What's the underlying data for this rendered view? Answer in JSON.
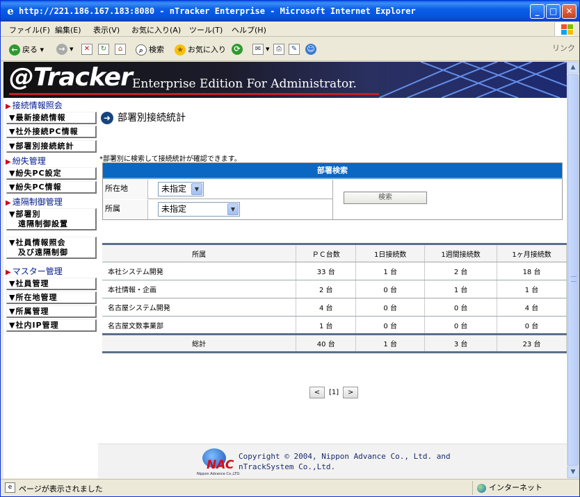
{
  "window": {
    "title": "http://221.186.167.183:8080 - nTracker Enterprise - Microsoft Internet Explorer",
    "minimize": "_",
    "maximize": "□",
    "close": "✕"
  },
  "menu": [
    "ファイル(F)",
    "編集(E)",
    "表示(V)",
    "お気に入り(A)",
    "ツール(T)",
    "ヘルプ(H)"
  ],
  "toolbar": {
    "back_label": "戻る",
    "search_label": "検索",
    "favorites_label": "お気に入り",
    "links_label": "リンク"
  },
  "banner": {
    "logo": "@Tracker",
    "edition": "Enterprise Edition For Administrator."
  },
  "sidebar": {
    "sections": [
      {
        "label": "接続情報照会",
        "items": [
          "▼最新接続情報",
          "▼社外接続PC情報",
          "▼部署別接続統計"
        ]
      },
      {
        "label": "紛失管理",
        "items": [
          "▼紛失PC設定",
          "▼紛失PC情報"
        ]
      },
      {
        "label": "遠隔制御管理",
        "items": [
          "▼部署別",
          "遠隔制御設置",
          "▼社員情報照会",
          "及び遠隔制御"
        ]
      },
      {
        "label": "マスター管理",
        "items": [
          "▼社員管理",
          "▼所在地管理",
          "▼所属管理",
          "▼社内IP管理"
        ]
      }
    ]
  },
  "page": {
    "title": "部署別接続統計",
    "note": "*部署別に検索して接続統計が確認できます。"
  },
  "search": {
    "header": "部署検索",
    "location_label": "所在地",
    "location_value": "未指定",
    "dept_label": "所属",
    "dept_value": "未指定",
    "button": "検索"
  },
  "table": {
    "headers": [
      "所属",
      "ＰＣ台数",
      "1日接続数",
      "1週間接続数",
      "1ヶ月接続数"
    ],
    "rows": [
      [
        "本社システム開発",
        "33 台",
        "1 台",
        "2 台",
        "18 台"
      ],
      [
        "本社情報・企画",
        "2 台",
        "0 台",
        "1 台",
        "1 台"
      ],
      [
        "名古屋システム開発",
        "4 台",
        "0 台",
        "0 台",
        "4 台"
      ],
      [
        "名古屋文数事業部",
        "1 台",
        "0 台",
        "0 台",
        "0 台"
      ]
    ],
    "total": [
      "総計",
      "40 台",
      "1 台",
      "3 台",
      "23 台"
    ]
  },
  "pager": {
    "prev": "<",
    "current": "[1]",
    "next": ">"
  },
  "footer": {
    "logo_text": "NAC",
    "logo_sub": "Nippon Advance Co.,LTD.",
    "copyright": "Copyright © 2004, Nippon Advance Co., Ltd. and nTrackSystem Co.,Ltd."
  },
  "status": {
    "text": "ページが表示されました",
    "zone": "インターネット"
  },
  "colors": {
    "title_bar": "#0453dc",
    "search_header": "#0a67c2",
    "section_label": "#001a8c",
    "accent_red": "#c41e2a"
  }
}
